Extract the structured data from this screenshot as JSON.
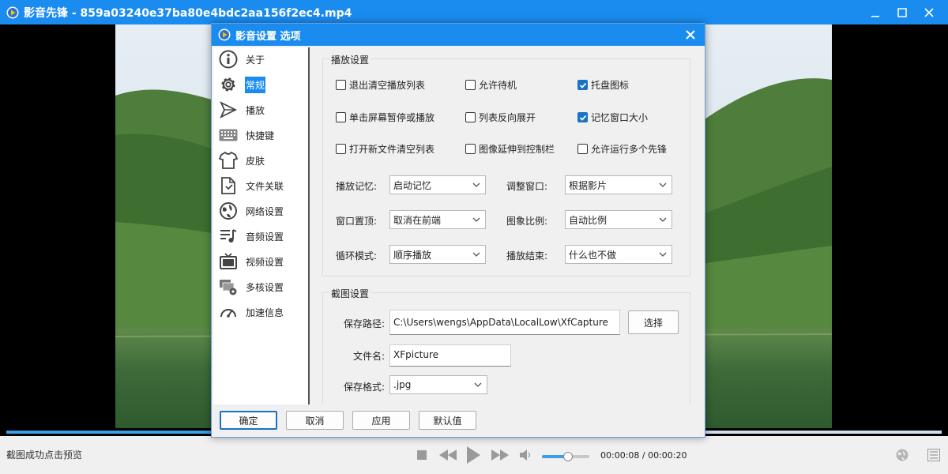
{
  "window": {
    "title": "影音先锋 - 859a03240e37ba80e4bdc2aa156f2ec4.mp4"
  },
  "dialog": {
    "title": "影音设置 选项",
    "nav": [
      {
        "label": "关于",
        "icon": "info-icon"
      },
      {
        "label": "常规",
        "icon": "gear-icon"
      },
      {
        "label": "播放",
        "icon": "play-icon"
      },
      {
        "label": "快捷键",
        "icon": "keyboard-icon"
      },
      {
        "label": "皮肤",
        "icon": "shirt-icon"
      },
      {
        "label": "文件关联",
        "icon": "file-link-icon"
      },
      {
        "label": "网络设置",
        "icon": "globe-icon"
      },
      {
        "label": "音频设置",
        "icon": "audio-icon"
      },
      {
        "label": "视频设置",
        "icon": "tv-icon"
      },
      {
        "label": "多核设置",
        "icon": "cores-icon"
      },
      {
        "label": "加速信息",
        "icon": "gauge-icon"
      }
    ],
    "active_nav": "常规",
    "playback": {
      "title": "播放设置",
      "checkboxes": [
        {
          "label": "退出清空播放列表",
          "checked": false
        },
        {
          "label": "允许待机",
          "checked": false
        },
        {
          "label": "托盘图标",
          "checked": true
        },
        {
          "label": "单击屏幕暂停或播放",
          "checked": false
        },
        {
          "label": "列表反向展开",
          "checked": false
        },
        {
          "label": "记忆窗口大小",
          "checked": true
        },
        {
          "label": "打开新文件清空列表",
          "checked": false
        },
        {
          "label": "图像延伸到控制栏",
          "checked": false
        },
        {
          "label": "允许运行多个先锋",
          "checked": false
        }
      ],
      "selects": [
        {
          "label": "播放记忆:",
          "value": "启动记忆"
        },
        {
          "label": "调整窗口:",
          "value": "根据影片"
        },
        {
          "label": "窗口置顶:",
          "value": "取消在前端"
        },
        {
          "label": "图象比例:",
          "value": "自动比例"
        },
        {
          "label": "循环模式:",
          "value": "顺序播放"
        },
        {
          "label": "播放结束:",
          "value": "什么也不做"
        }
      ]
    },
    "capture": {
      "title": "截图设置",
      "path_label": "保存路径:",
      "path_value": "C:\\Users\\wengs\\AppData\\LocalLow\\XfCapture",
      "choose_label": "选择",
      "filename_label": "文件名:",
      "filename_value": "XFpicture",
      "format_label": "保存格式:",
      "format_value": ".jpg"
    },
    "buttons": {
      "ok": "确定",
      "cancel": "取消",
      "apply": "应用",
      "default": "默认值"
    }
  },
  "status": {
    "message": "截图成功点击预览",
    "time": "00:00:08 / 00:00:20",
    "progress_fraction": 0.4,
    "volume_fraction": 0.55
  },
  "colors": {
    "titlebar": "#1a8cf0",
    "accent": "#1a72c8"
  }
}
